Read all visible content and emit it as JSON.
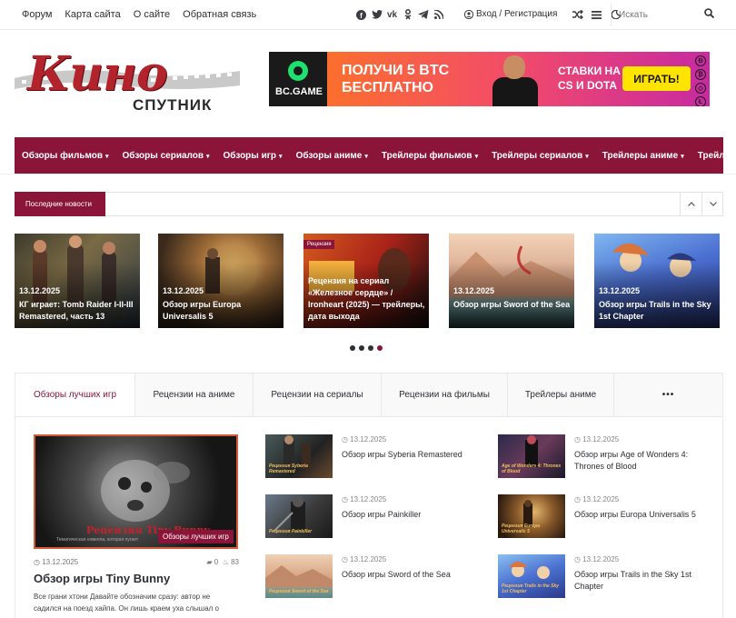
{
  "topbar": {
    "links": [
      "Форум",
      "Карта сайта",
      "О сайте",
      "Обратная связь"
    ],
    "social_icons": [
      "facebook-icon",
      "twitter-icon",
      "vk-icon",
      "odnoklassniki-icon",
      "telegram-icon",
      "rss-icon"
    ],
    "login_label": "Вход / Регистрация",
    "search_placeholder": "Искать"
  },
  "logo": {
    "main": "Кино",
    "sub": "СПУТНИК"
  },
  "banner": {
    "brand": "BC.GAME",
    "line1": "ПОЛУЧИ 5 BTC",
    "line2": "БЕСПЛАТНО",
    "line3": "СТАВКИ НА",
    "line4": "CS И DOTA",
    "cta": "ИГРАТЬ!",
    "accent_from": "#ff7a1a",
    "accent_to": "#c72aa0"
  },
  "nav": {
    "items": [
      "Обзоры фильмов",
      "Обзоры сериалов",
      "Обзоры игр",
      "Обзоры аниме",
      "Трейлеры фильмов",
      "Трейлеры сериалов",
      "Трейлеры аниме",
      "Трейлеры игр"
    ],
    "color": "#8a1538"
  },
  "ticker": {
    "label": "Последние новости"
  },
  "slider": {
    "slides": [
      {
        "date": "13.12.2025",
        "title": "КГ играет: Tomb Raider I-II-III Remastered, часть 13",
        "tag": ""
      },
      {
        "date": "13.12.2025",
        "title": "Обзор игры Europa Universalis 5",
        "tag": ""
      },
      {
        "date": "13.12.2025",
        "title": "Рецензия на сериал «Железное сердце» / Ironheart (2025) — трейлеры, дата выхода",
        "tag": "Рецензия"
      },
      {
        "date": "13.12.2025",
        "title": "Обзор игры Sword of the Sea",
        "tag": ""
      },
      {
        "date": "13.12.2025",
        "title": "Обзор игры Trails in the Sky 1st Chapter",
        "tag": ""
      }
    ],
    "page_count": 4,
    "active_page": 4
  },
  "tabs": {
    "items": [
      "Обзоры лучших игр",
      "Рецензии на аниме",
      "Рецензии на сериалы",
      "Рецензии на фильмы",
      "Трейлеры аниме",
      "•••"
    ],
    "active": 0
  },
  "featured": {
    "image_caption": "Рецензия Tiny Bunny",
    "image_subcaption": "Тематическая новелла, которая пугает",
    "category": "Обзоры лучших игр",
    "date": "13.12.2025",
    "comments": "0",
    "views": "83",
    "title": "Обзор игры Tiny Bunny",
    "excerpt": "Все грани хтони Давайте обозначим сразу: автор не садился на поезд хайпа. Он лишь краем уха слышал о"
  },
  "list_col1": [
    {
      "date": "13.12.2025",
      "title": "Обзор игры Syberia Remastered",
      "caption": "Рецензия Syberia Remastered"
    },
    {
      "date": "13.12.2025",
      "title": "Обзор игры Painkiller",
      "caption": "Рецензия Painkiller"
    },
    {
      "date": "13.12.2025",
      "title": "Обзор игры Sword of the Sea",
      "caption": "Рецензия Sword of the Sea"
    }
  ],
  "list_col2": [
    {
      "date": "13.12.2025",
      "title": "Обзор игры Age of Wonders 4: Thrones of Blood",
      "caption": "Age of Wonders 4: Thrones of Blood"
    },
    {
      "date": "13.12.2025",
      "title": "Обзор игры Europa Universalis 5",
      "caption": "Рецензия Europa Universalis 5"
    },
    {
      "date": "13.12.2025",
      "title": "Обзор игры Trails in the Sky 1st Chapter",
      "caption": "Рецензия Trails in the Sky 1st Chapter"
    }
  ]
}
